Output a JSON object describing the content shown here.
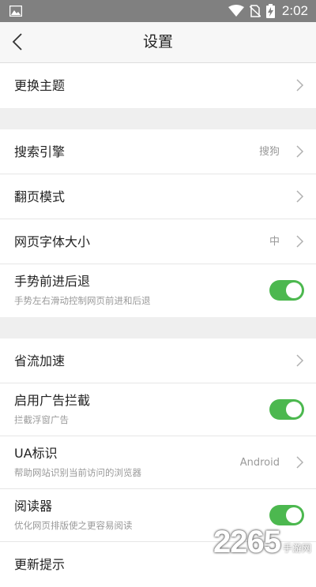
{
  "status_bar": {
    "time": "2:02"
  },
  "header": {
    "title": "设置"
  },
  "groups": [
    {
      "items": [
        {
          "label": "更换主题"
        }
      ]
    },
    {
      "items": [
        {
          "label": "搜索引擎",
          "value": "搜狗"
        },
        {
          "label": "翻页模式"
        },
        {
          "label": "网页字体大小",
          "value": "中"
        },
        {
          "label": "手势前进后退",
          "subtitle": "手势左右滑动控制网页前进和后退",
          "toggle_on": true
        }
      ]
    },
    {
      "items": [
        {
          "label": "省流加速"
        },
        {
          "label": "启用广告拦截",
          "subtitle": "拦截浮窗广告",
          "toggle_on": true
        },
        {
          "label": "UA标识",
          "subtitle": "帮助网站识别当前访问的浏览器",
          "value": "Android"
        },
        {
          "label": "阅读器",
          "subtitle": "优化网页排版使之更容易阅读",
          "toggle_on": true
        },
        {
          "label": "更新提示"
        }
      ]
    }
  ],
  "watermark": {
    "number": "2265",
    "text": "手游网"
  },
  "colors": {
    "toggle_on": "#4cb84f",
    "status_bar": "#808080"
  },
  "icons": [
    "image-icon",
    "wifi-icon",
    "no-sim-icon",
    "battery-charging-icon",
    "back-icon",
    "chevron-right-icon",
    "toggle-switch"
  ]
}
